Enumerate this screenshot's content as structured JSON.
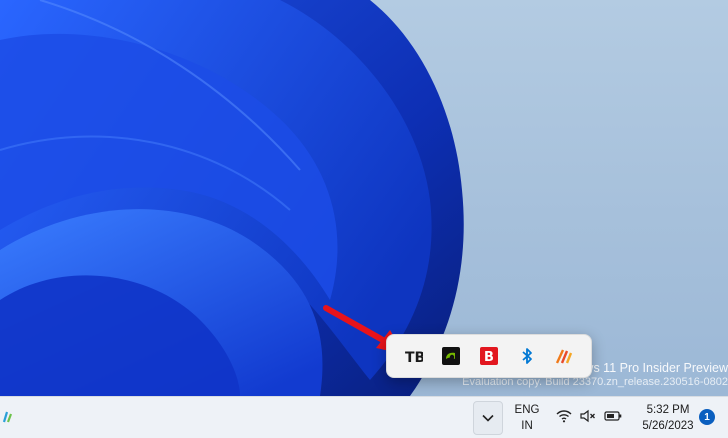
{
  "desktop": {
    "watermark_line1": "Windows 11 Pro Insider Preview",
    "watermark_line2": "Evaluation copy. Build 23370.zn_release.230516-0802"
  },
  "overflow_tray": {
    "apps": [
      {
        "name": "TranslucentTB",
        "icon": "translucenttb-icon",
        "glyph": "TB",
        "color": "#1a1a1a"
      },
      {
        "name": "NVIDIA",
        "icon": "nvidia-icon",
        "color": "#76b900"
      },
      {
        "name": "Bitdefender",
        "icon": "bitdefender-icon",
        "glyph": "B",
        "color": "#e2171f"
      },
      {
        "name": "Bluetooth",
        "icon": "bluetooth-icon",
        "color": "#0078d4"
      },
      {
        "name": "Bars app",
        "icon": "bars-app-icon",
        "color": "#f07a1a"
      }
    ]
  },
  "taskbar": {
    "chevron_icon": "chevron-down-icon",
    "language": {
      "line1": "ENG",
      "line2": "IN"
    },
    "system_icons": [
      "wifi-icon",
      "volume-muted-icon",
      "battery-icon"
    ],
    "clock": {
      "time": "5:32 PM",
      "date": "5/26/2023"
    },
    "notification_count": "1"
  },
  "colors": {
    "accent": "#0a5fbf",
    "annotation_arrow": "#e8131b",
    "bloom_dark": "#0a2a9a",
    "bloom_light": "#2e6bff"
  }
}
